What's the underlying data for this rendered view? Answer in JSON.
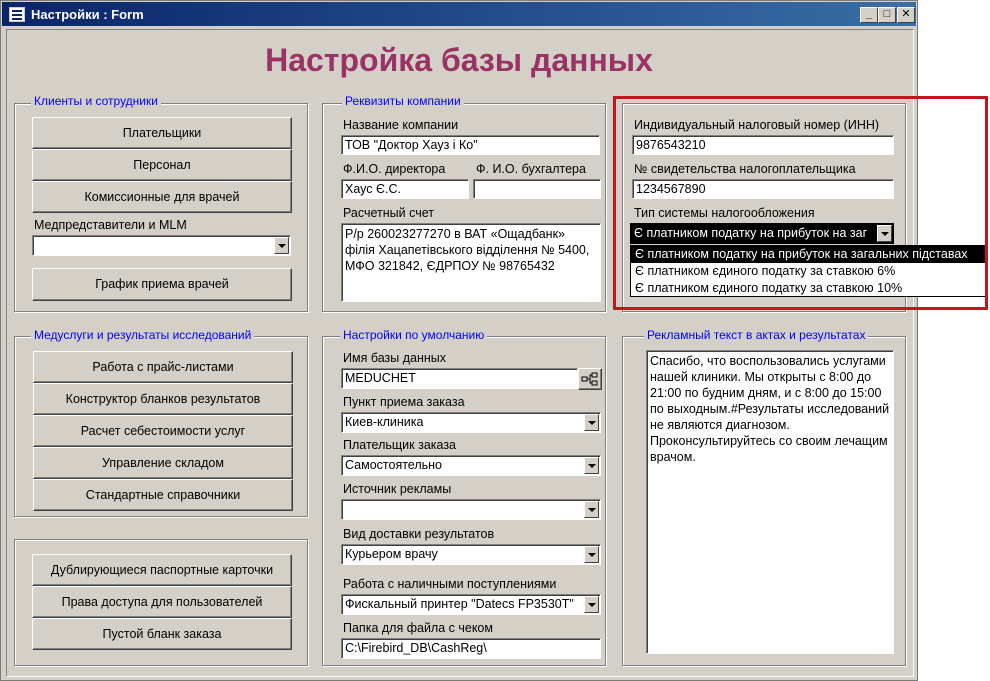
{
  "window": {
    "title": "Настройки : Form"
  },
  "page_title": "Настройка базы данных",
  "clients": {
    "legend": "Клиенты и сотрудники",
    "buttons": [
      "Плательщики",
      "Персонал",
      "Комиссионные для врачей"
    ],
    "med_reps_label": "Медпредставители и MLM",
    "med_reps_value": "",
    "schedule_button": "График приема врачей"
  },
  "company": {
    "legend": "Реквизиты компании",
    "name_label": "Название компании",
    "name_value": "ТОВ \"Доктор Хауз і Ко\"",
    "director_label": "Ф.И.О. директора",
    "director_value": "Хаус Є.С.",
    "accountant_label": "Ф. И.О. бухгалтера",
    "accountant_value": "",
    "account_label": "Расчетный счет",
    "account_value": "Р/р 260023277270 в ВАТ «Ощадбанк» філія Хацапетівського відділення № 5400, МФО 321842, ЄДРПОУ № 98765432"
  },
  "tax": {
    "inn_label": "Индивидуальный налоговый номер (ИНН)",
    "inn_value": "9876543210",
    "cert_label": "№ свидетельства налогоплательщика",
    "cert_value": "1234567890",
    "system_label": "Тип системы налогообложения",
    "system_value": "Є платником податку на прибуток на заг",
    "options": [
      "Є платником податку на прибуток на загальних підставах",
      "Є платником єдиного податку за ставкою 6%",
      "Є платником єдиного податку за ставкою 10%"
    ]
  },
  "services": {
    "legend": "Медуслуги и результаты исследований",
    "buttons": [
      "Работа с прайс-листами",
      "Конструктор бланков результатов",
      "Расчет себестоимости услуг",
      "Управление складом",
      "Стандартные справочники"
    ]
  },
  "misc_buttons": [
    "Дублирующиеся паспортные карточки",
    "Права доступа для пользователей",
    "Пустой бланк заказа"
  ],
  "defaults": {
    "legend": "Настройки по умолчанию",
    "db_label": "Имя базы данных",
    "db_value": "MEDUCHET",
    "order_point_label": "Пункт приема заказа",
    "order_point_value": "Киев-клиника",
    "payer_label": "Плательщик заказа",
    "payer_value": "Самостоятельно",
    "ad_source_label": "Источник рекламы",
    "ad_source_value": "",
    "delivery_label": "Вид доставки результатов",
    "delivery_value": "Курьером врачу",
    "cash_label": "Работа с наличными поступлениями",
    "cash_value": "Фискальный принтер \"Datecs FP3530T\"",
    "folder_label": "Папка для файла с чеком",
    "folder_value": "C:\\Firebird_DB\\CashReg\\"
  },
  "ad_text": {
    "legend": "Рекламный текст в актах и результатах",
    "value": "Спасибо, что воспользовались услугами нашей клиники. Мы открыты с 8:00 до 21:00 по будним дням, и с 8:00 до 15:00 по выходным.#Результаты исследований не являются диагнозом. Проконсультируйтесь со своим лечащим врачом."
  }
}
